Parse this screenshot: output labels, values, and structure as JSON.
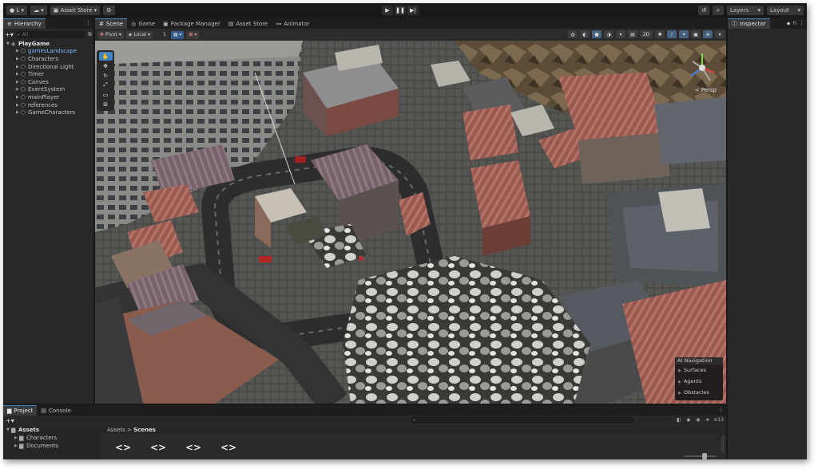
{
  "toolbar": {
    "account_label": "L",
    "asset_store_label": "Asset Store",
    "layers_label": "Layers",
    "layout_label": "Layout"
  },
  "hierarchy": {
    "tab_label": "Hierarchy",
    "search_placeholder": "All",
    "items": [
      {
        "label": "PlayGame",
        "depth": 0,
        "root": true
      },
      {
        "label": "gamesLandscape",
        "depth": 1,
        "selected": true
      },
      {
        "label": "Characters",
        "depth": 1
      },
      {
        "label": "Directional Light",
        "depth": 1
      },
      {
        "label": "Timer",
        "depth": 1
      },
      {
        "label": "Canves",
        "depth": 1
      },
      {
        "label": "EventSystem",
        "depth": 1
      },
      {
        "label": "mainPlayer",
        "depth": 1
      },
      {
        "label": "references",
        "depth": 1
      },
      {
        "label": "GameCharacters",
        "depth": 1
      }
    ]
  },
  "scene_tabs": [
    {
      "label": "Scene",
      "icon": "scene-icon",
      "active": true
    },
    {
      "label": "Game",
      "icon": "game-icon"
    },
    {
      "label": "Package Manager",
      "icon": "package-icon"
    },
    {
      "label": "Asset Store",
      "icon": "store-icon"
    },
    {
      "label": "Animator",
      "icon": "animator-icon"
    }
  ],
  "scene_toolbar": {
    "pivot_label": "Pivot",
    "local_label": "Local",
    "grid_value": "1",
    "mode_2d": "2D"
  },
  "viewport": {
    "persp_label": "< Persp",
    "ai_navigation": {
      "title": "AI Navigation",
      "items": [
        "Surfaces",
        "Agents",
        "Obstacles"
      ]
    }
  },
  "inspector": {
    "tab_label": "Inspector"
  },
  "project": {
    "tabs": [
      {
        "label": "Project",
        "active": true
      },
      {
        "label": "Console"
      }
    ],
    "tree": [
      {
        "label": "Assets",
        "depth": 0,
        "root": true
      },
      {
        "label": "Characters",
        "depth": 1
      },
      {
        "label": "Documents",
        "depth": 1
      }
    ],
    "breadcrumb_root": "Assets",
    "breadcrumb_current": "Scenes",
    "hidden_count": "13",
    "asset_tiles": [
      "<>",
      "<>",
      "<>",
      "<>"
    ]
  }
}
